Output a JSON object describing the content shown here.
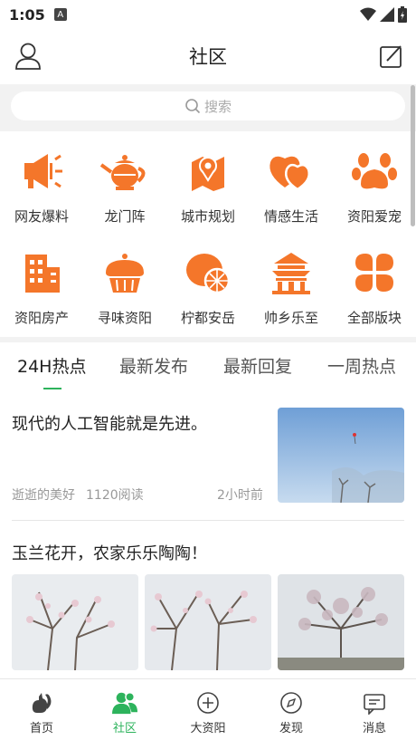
{
  "status_bar": {
    "time": "1:05",
    "notif": "A"
  },
  "header": {
    "title": "社区"
  },
  "search": {
    "placeholder": "搜索"
  },
  "categories": [
    {
      "label": "网友爆料",
      "icon": "megaphone-icon"
    },
    {
      "label": "龙门阵",
      "icon": "teapot-icon"
    },
    {
      "label": "城市规划",
      "icon": "map-pin-icon"
    },
    {
      "label": "情感生活",
      "icon": "hearts-icon"
    },
    {
      "label": "资阳爱宠",
      "icon": "paw-icon"
    },
    {
      "label": "资阳房产",
      "icon": "building-icon"
    },
    {
      "label": "寻味资阳",
      "icon": "cupcake-icon"
    },
    {
      "label": "柠都安岳",
      "icon": "lemon-icon"
    },
    {
      "label": "帅乡乐至",
      "icon": "pavilion-icon"
    },
    {
      "label": "全部版块",
      "icon": "clover-icon"
    }
  ],
  "tabs": [
    {
      "label": "24H热点",
      "active": true
    },
    {
      "label": "最新发布",
      "active": false
    },
    {
      "label": "最新回复",
      "active": false
    },
    {
      "label": "一周热点",
      "active": false
    }
  ],
  "posts": [
    {
      "title": "现代的人工智能就是先进。",
      "author": "逝逝的美好",
      "reads": "1120阅读",
      "time": "2小时前"
    },
    {
      "title": "玉兰花开，农家乐乐陶陶！"
    }
  ],
  "nav": [
    {
      "label": "首页",
      "icon": "squirrel-icon",
      "active": false
    },
    {
      "label": "社区",
      "icon": "people-icon",
      "active": true
    },
    {
      "label": "大资阳",
      "icon": "plus-circle-icon",
      "active": false
    },
    {
      "label": "发现",
      "icon": "compass-icon",
      "active": false
    },
    {
      "label": "消息",
      "icon": "message-icon",
      "active": false
    }
  ],
  "colors": {
    "accent": "#2db35c",
    "icon_orange": "#f4762a"
  }
}
